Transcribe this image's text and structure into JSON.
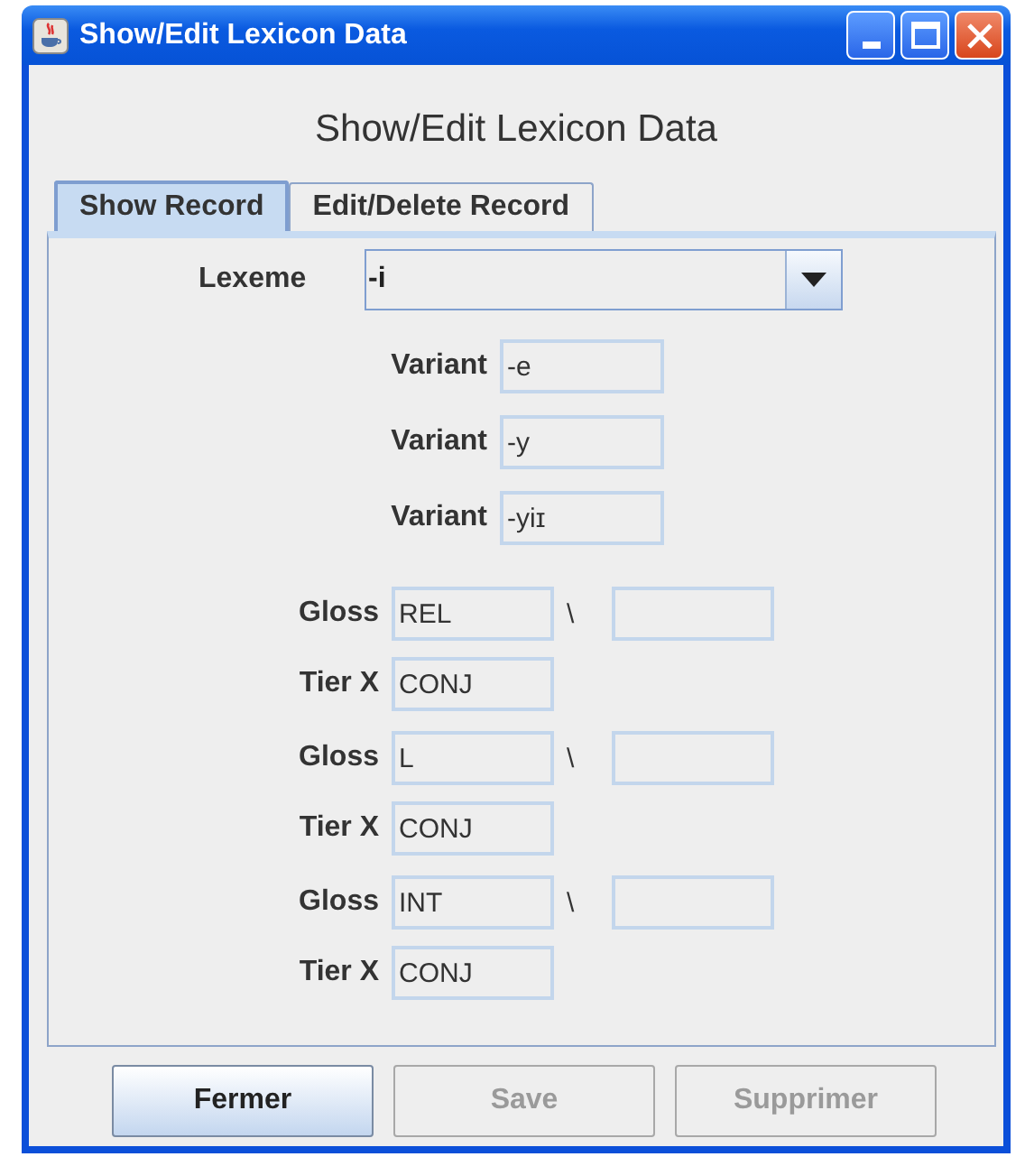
{
  "window": {
    "title": "Show/Edit Lexicon Data"
  },
  "heading": "Show/Edit Lexicon Data",
  "tabs": [
    {
      "label": "Show Record",
      "selected": true
    },
    {
      "label": "Edit/Delete Record",
      "selected": false
    }
  ],
  "lexeme": {
    "label": "Lexeme",
    "value": "-i"
  },
  "variants": [
    {
      "label": "Variant",
      "value": "-e"
    },
    {
      "label": "Variant",
      "value": "-y"
    },
    {
      "label": "Variant",
      "value": "-yiɪ"
    }
  ],
  "glosses": [
    {
      "label": "Gloss",
      "value": "REL",
      "separator": "\\",
      "tier_label": "Tier X",
      "tier_value": "CONJ"
    },
    {
      "label": "Gloss",
      "value": "L",
      "separator": "\\",
      "tier_label": "Tier X",
      "tier_value": "CONJ"
    },
    {
      "label": "Gloss",
      "value": "INT",
      "separator": "\\",
      "tier_label": "Tier X",
      "tier_value": "CONJ"
    }
  ],
  "buttons": [
    {
      "label": "Fermer",
      "disabled": false
    },
    {
      "label": "Save",
      "disabled": true
    },
    {
      "label": "Supprimer",
      "disabled": true
    }
  ]
}
